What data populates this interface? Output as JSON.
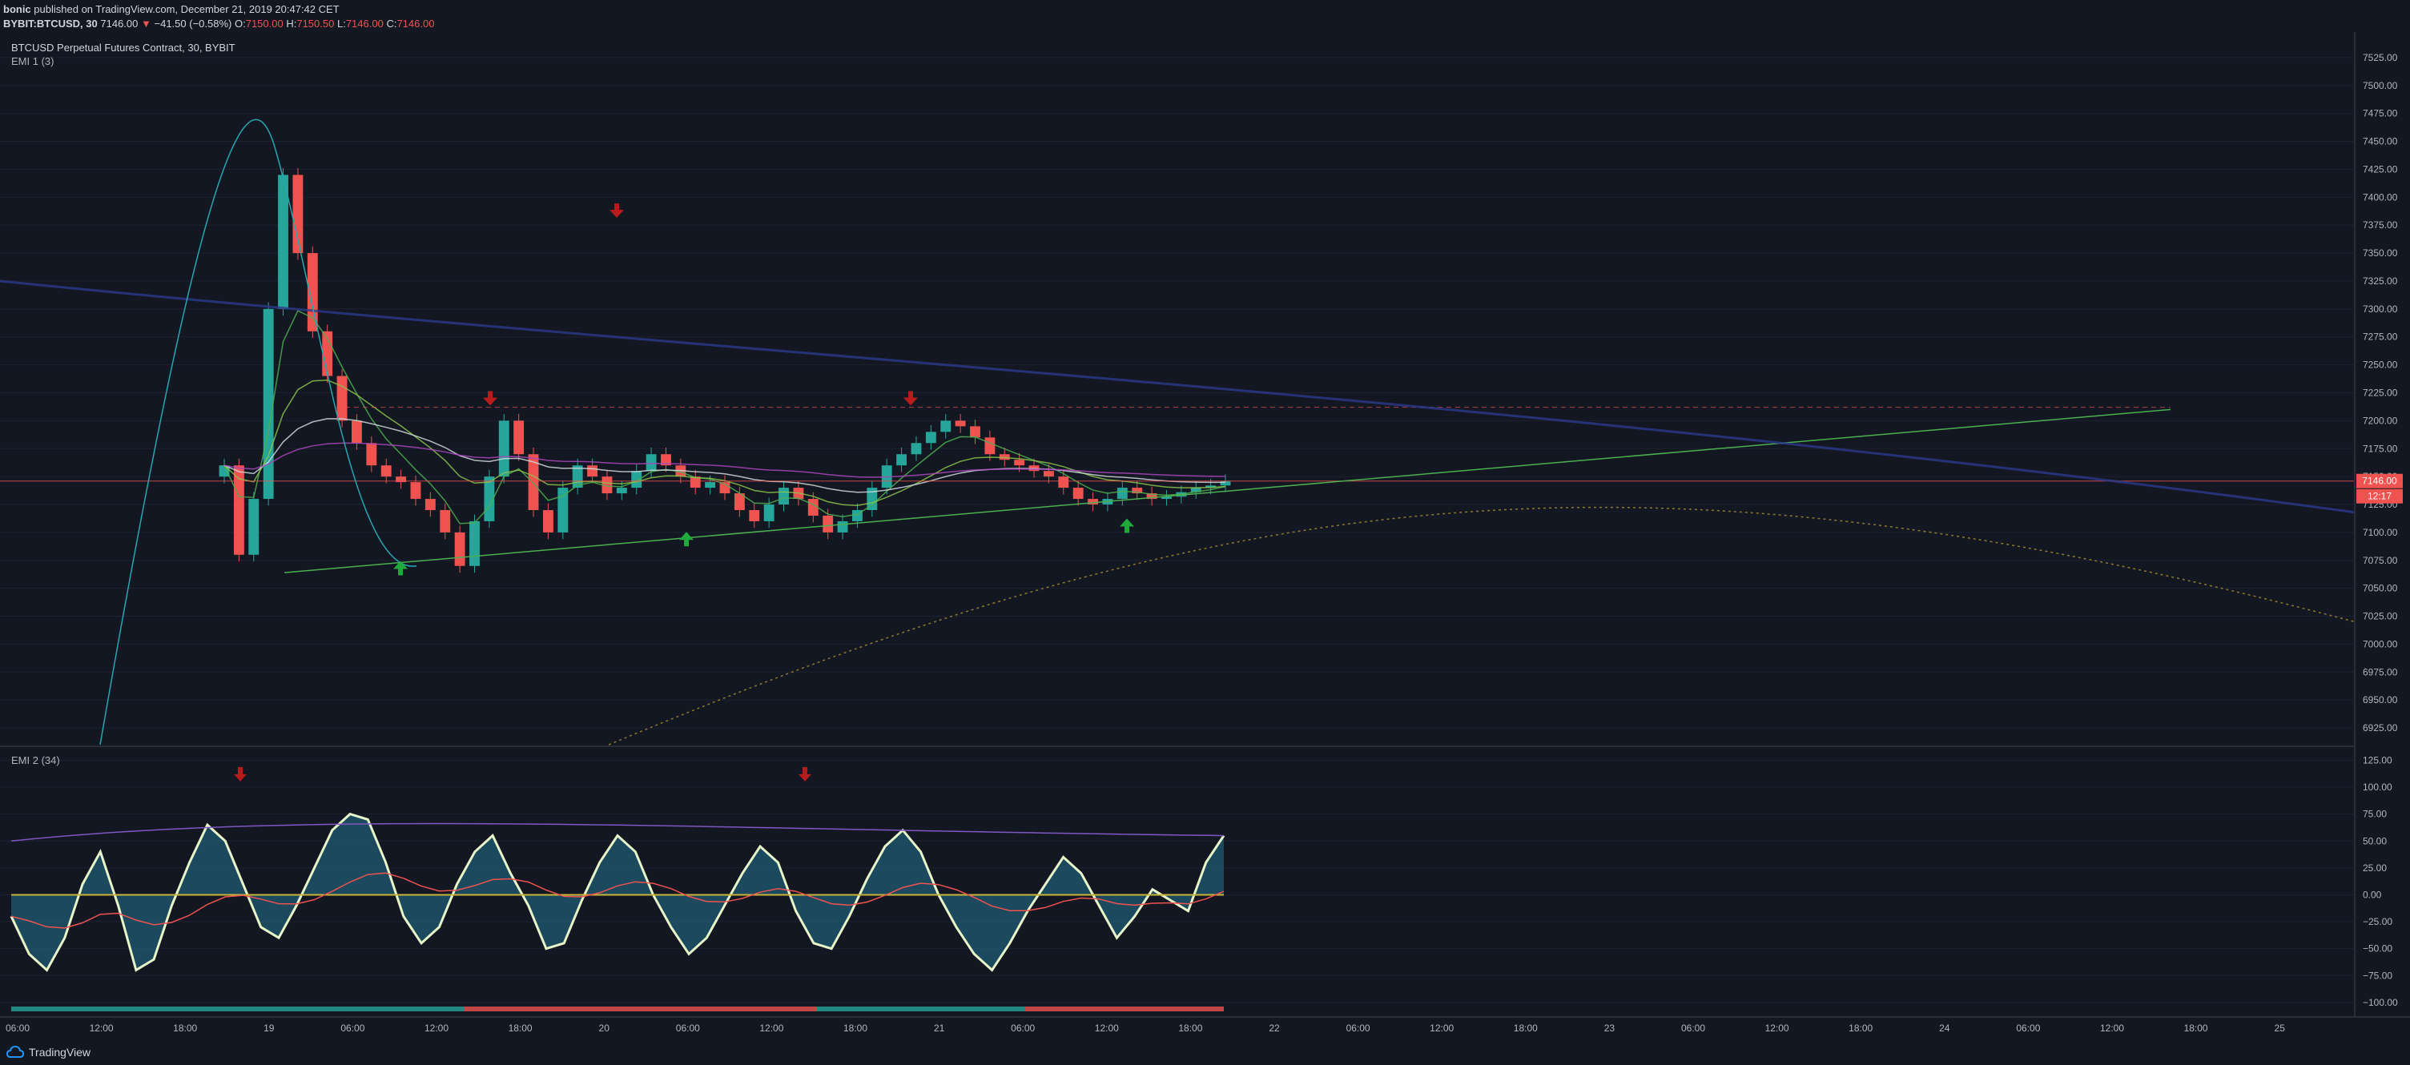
{
  "header": {
    "author": "bonic",
    "published": "published on TradingView.com, December 21, 2019 20:47:42 CET",
    "symbol": "BYBIT:BTCUSD, 30",
    "last": "7146.00",
    "change_arrow": "▼",
    "change": "−41.50 (−0.58%)",
    "o_label": "O:",
    "o": "7150.00",
    "h_label": "H:",
    "h": "7150.50",
    "l_label": "L:",
    "l": "7146.00",
    "c_label": "C:",
    "c": "7146.00"
  },
  "chart_data": {
    "type": "candlestick",
    "title": "BTCUSD Perpetual Futures Contract, 30, BYBIT",
    "indicator_label": "EMI 1 (3)",
    "price_axis": {
      "ticks": [
        "7525.00",
        "7500.00",
        "7475.00",
        "7450.00",
        "7425.00",
        "7400.00",
        "7375.00",
        "7350.00",
        "7325.00",
        "7300.00",
        "7275.00",
        "7250.00",
        "7225.00",
        "7200.00",
        "7175.00",
        "7150.00",
        "7125.00",
        "7100.00",
        "7075.00",
        "7050.00",
        "7025.00",
        "7000.00",
        "6975.00",
        "6950.00",
        "6925.00"
      ],
      "range": [
        6910,
        7545
      ]
    },
    "last_price_label": "7146.00",
    "countdown_label": "12:17",
    "last_price": 7146,
    "resistance": 7212,
    "candles_close": [
      7160,
      7080,
      7130,
      7300,
      7420,
      7350,
      7280,
      7240,
      7200,
      7180,
      7160,
      7150,
      7145,
      7130,
      7120,
      7100,
      7070,
      7110,
      7150,
      7200,
      7170,
      7120,
      7100,
      7140,
      7160,
      7150,
      7135,
      7140,
      7155,
      7170,
      7160,
      7150,
      7140,
      7145,
      7135,
      7120,
      7110,
      7125,
      7140,
      7130,
      7115,
      7100,
      7110,
      7120,
      7140,
      7160,
      7170,
      7180,
      7190,
      7200,
      7195,
      7185,
      7170,
      7165,
      7160,
      7155,
      7150,
      7140,
      7130,
      7125,
      7130,
      7140,
      7135,
      7130,
      7132,
      7136,
      7140,
      7142,
      7146
    ],
    "oscillator": {
      "label": "EMI 2 (34)",
      "ticks": [
        "125.00",
        "100.00",
        "75.00",
        "50.00",
        "25.00",
        "0.00",
        "−25.00",
        "−50.00",
        "−75.00",
        "−100.00"
      ],
      "range": [
        -112,
        135
      ],
      "values": [
        -20,
        -55,
        -70,
        -40,
        10,
        40,
        -10,
        -70,
        -60,
        -10,
        30,
        65,
        50,
        10,
        -30,
        -40,
        -10,
        25,
        60,
        75,
        70,
        30,
        -20,
        -45,
        -30,
        10,
        40,
        55,
        20,
        -10,
        -50,
        -45,
        -5,
        30,
        55,
        40,
        0,
        -30,
        -55,
        -40,
        -10,
        20,
        45,
        30,
        -15,
        -45,
        -50,
        -20,
        15,
        45,
        60,
        40,
        0,
        -30,
        -55,
        -70,
        -45,
        -15,
        10,
        35,
        20,
        -10,
        -40,
        -20,
        5,
        -5,
        -15,
        30,
        55
      ]
    },
    "time_axis": [
      "06:00",
      "12:00",
      "18:00",
      "19",
      "06:00",
      "12:00",
      "18:00",
      "20",
      "06:00",
      "12:00",
      "18:00",
      "21",
      "06:00",
      "12:00",
      "18:00",
      "22",
      "06:00",
      "12:00",
      "18:00",
      "23",
      "06:00",
      "12:00",
      "18:00",
      "24",
      "06:00",
      "12:00",
      "18:00",
      "25"
    ]
  },
  "footer": {
    "brand": "TradingView"
  },
  "colors": {
    "bg": "#131722",
    "up": "#26a69a",
    "down": "#ef5350",
    "grid": "#1e2230",
    "axis_text": "#b2b5be"
  }
}
